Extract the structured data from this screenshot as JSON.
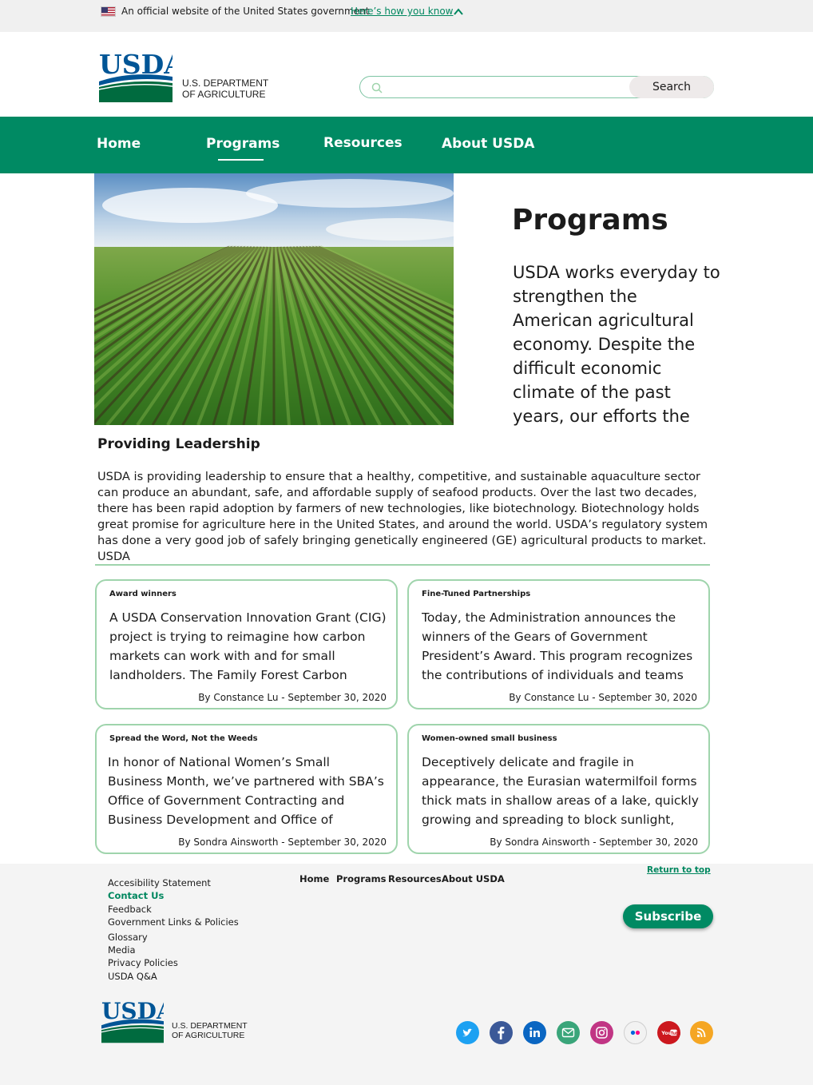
{
  "gov_banner": {
    "text": "An official website of the United States government",
    "link": "Here’s how you know",
    "flag_icon": "us-flag-icon",
    "chevron_icon": "chevron-up-icon"
  },
  "header": {
    "logo_text": "USDA",
    "dept_line1": "U.S. DEPARTMENT",
    "dept_line2": "OF AGRICULTURE",
    "search_placeholder": "",
    "search_button": "Search"
  },
  "nav": {
    "items": [
      {
        "label": "Home"
      },
      {
        "label": "Programs"
      },
      {
        "label": "Resources"
      },
      {
        "label": "About USDA"
      }
    ],
    "active": "Programs"
  },
  "hero": {
    "title": "Programs",
    "text": "USDA works everyday to strengthen the American agricultural economy. Despite the difficult economic climate of the past years, our efforts the"
  },
  "leadership": {
    "title": "Providing Leadership",
    "text": "USDA is providing leadership to ensure that a healthy, competitive, and sustainable aquaculture sector can produce an abundant, safe, and affordable supply of seafood products. Over the last two decades, there has been rapid adoption by farmers of new technologies, like biotechnology. Biotechnology holds great promise for agriculture here in the United States, and around the world. USDA’s regulatory system has done a very good job of safely bringing genetically engineered (GE) agricultural products to market.  USDA"
  },
  "cards": [
    {
      "tag": "Award winners",
      "body": "A USDA Conservation Innovation Grant (CIG) project is trying to reimagine how carbon markets can work with and for small landholders. The Family Forest Carbon Program",
      "byline": "By Constance Lu - September 30, 2020"
    },
    {
      "tag": "Fine-Tuned Partnerships",
      "body": "Today, the Administration announces the winners of the Gears of Government President’s Award. This program recognizes the contributions of individuals and teams across",
      "byline": "By Constance Lu - September 30, 2020"
    },
    {
      "tag": "Spread the Word, Not the Weeds",
      "body": "In honor of National Women’s Small Business Month, we’ve partnered with SBA’s Office of Government Contracting and Business Development and Office of Program",
      "byline": "By Sondra Ainsworth - September 30, 2020"
    },
    {
      "tag": "Women-owned small business",
      "body": "Deceptively delicate and fragile in appearance, the Eurasian watermilfoil forms thick mats in shallow areas of a lake, quickly growing and spreading to block sunlight, killing off native",
      "byline": "By Sondra Ainsworth - September 30, 2020"
    }
  ],
  "footer": {
    "links": [
      {
        "label": "Accesibility Statement"
      },
      {
        "label": "Contact Us"
      },
      {
        "label": "Feedback"
      },
      {
        "label": "Government Links & Policies"
      },
      {
        "label": "Glossary"
      },
      {
        "label": "Media"
      },
      {
        "label": "Privacy Policies"
      },
      {
        "label": "USDA Q&A"
      }
    ],
    "nav": [
      {
        "label": "Home"
      },
      {
        "label": "Programs"
      },
      {
        "label": "Resources"
      },
      {
        "label": "About USDA"
      }
    ],
    "return_top": "Return to top",
    "subscribe": "Subscribe",
    "logo_text": "USDA",
    "dept_line1": "U.S. DEPARTMENT",
    "dept_line2": "OF AGRICULTURE",
    "social": [
      {
        "icon": "twitter-icon",
        "color": "#1da1f2"
      },
      {
        "icon": "facebook-icon",
        "color": "#3b5998"
      },
      {
        "icon": "linkedin-icon",
        "color": "#0a66c2"
      },
      {
        "icon": "email-icon",
        "color": "#3aa57a"
      },
      {
        "icon": "instagram-icon",
        "color": "#c13584"
      },
      {
        "icon": "flickr-icon",
        "color": "#e6e6e6"
      },
      {
        "icon": "youtube-icon",
        "color": "#cc181e"
      },
      {
        "icon": "rss-icon",
        "color": "#f5a623"
      }
    ]
  },
  "colors": {
    "brand_green": "#008a63",
    "link_green": "#00875f",
    "card_border": "#9fd4ac",
    "usda_blue": "#005596"
  }
}
